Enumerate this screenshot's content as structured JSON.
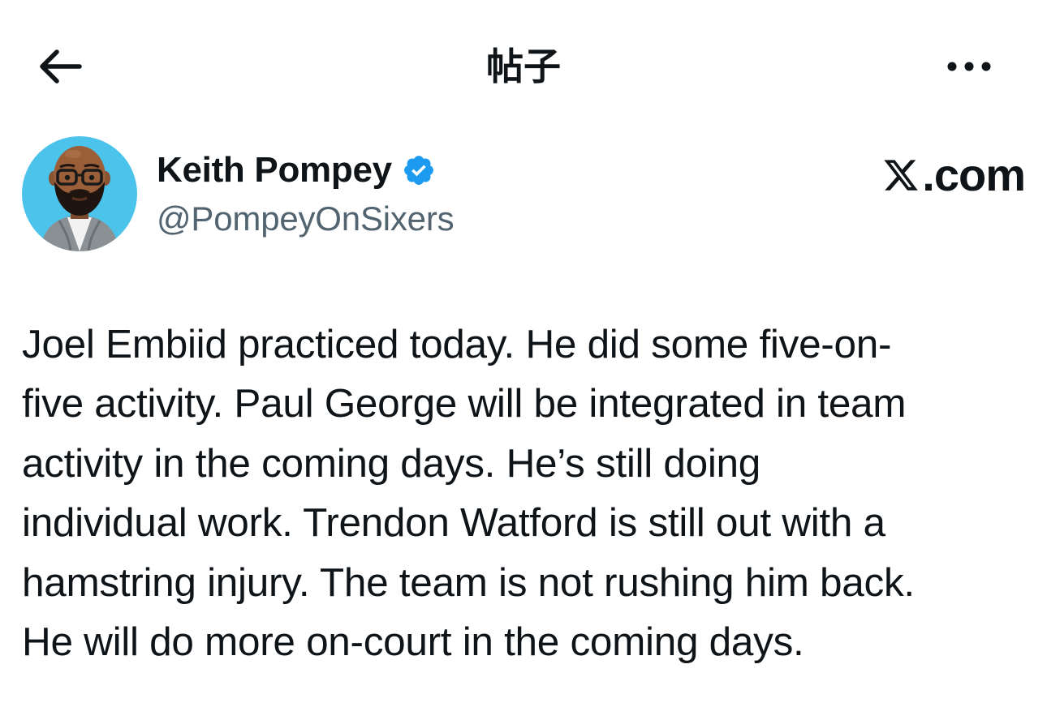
{
  "header": {
    "title": "帖子",
    "back_icon": "arrow-left-icon",
    "more_icon": "more-horizontal-icon"
  },
  "author": {
    "display_name": "Keith Pompey",
    "handle": "@PompeyOnSixers",
    "verified": true,
    "avatar_icon": "memoji-avatar",
    "badge_icon": "verified-badge-icon"
  },
  "brand": {
    "text": ".com",
    "logo_icon": "x-logo-icon"
  },
  "tweet": {
    "lines": [
      "Joel Embiid practiced today. He did some five-on-",
      "five activity. Paul George will be integrated in team",
      "activity in the coming days.  He’s still doing",
      "individual work. Trendon Watford is still out with a",
      "hamstring injury. The team is not rushing him back.",
      "He will do more on-court in the coming days."
    ]
  },
  "colors": {
    "text": "#0f1419",
    "secondary": "#536471",
    "verified_blue": "#1d9bf0",
    "avatar_bg": "#4cc3ea"
  }
}
